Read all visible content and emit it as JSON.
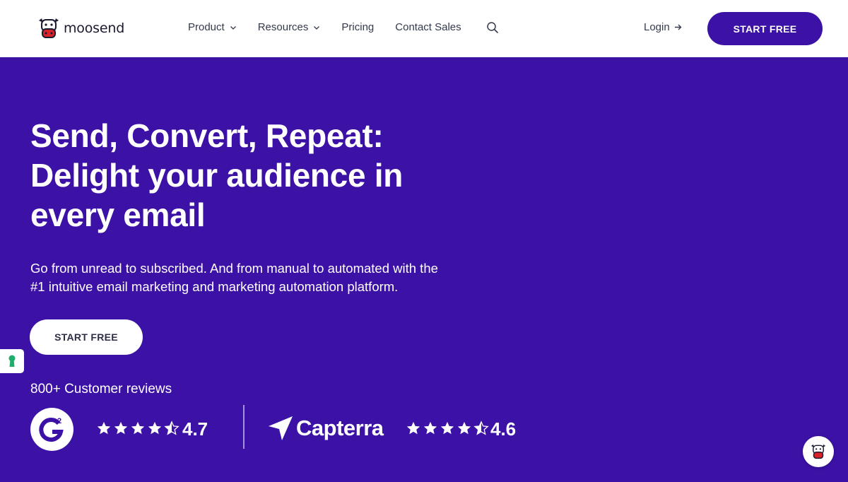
{
  "brand": {
    "name": "moosend",
    "logo_icon": "cow-logo-icon"
  },
  "nav": {
    "items": [
      {
        "label": "Product",
        "has_dropdown": true
      },
      {
        "label": "Resources",
        "has_dropdown": true
      },
      {
        "label": "Pricing",
        "has_dropdown": false
      },
      {
        "label": "Contact Sales",
        "has_dropdown": false
      }
    ],
    "search_icon": "search-icon",
    "login_label": "Login",
    "start_free_label": "START FREE"
  },
  "hero": {
    "title_line1": "Send, Convert, Repeat:",
    "title_line2": "Delight your audience in",
    "title_line3": "every email",
    "subtitle_line1": "Go from unread to subscribed. And from manual to automated with the",
    "subtitle_line2": "#1 intuitive email marketing and marketing automation platform.",
    "cta_label": "START FREE"
  },
  "reviews": {
    "label": "800+ Customer reviews",
    "g2": {
      "rating": "4.7",
      "stars": 4.5,
      "badge_text": "2"
    },
    "capterra": {
      "name": "Capterra",
      "rating": "4.6",
      "stars": 4.5
    }
  },
  "colors": {
    "brand_purple": "#3c11a6",
    "white": "#ffffff",
    "nav_text": "#333a4d",
    "accessibility_green": "#1eae6a",
    "logo_red": "#d8232a"
  }
}
